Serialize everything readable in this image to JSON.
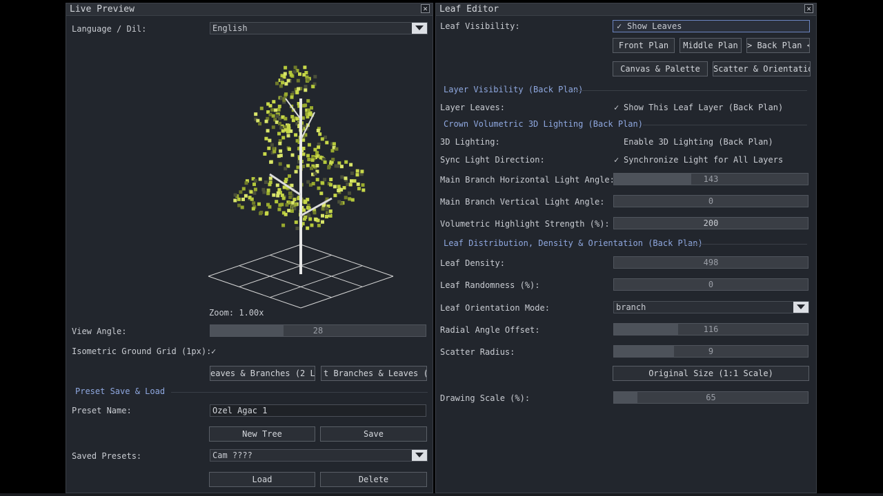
{
  "left_window": {
    "title": "Live Preview",
    "language_label": "Language / Dil:",
    "language_value": "English",
    "zoom_text": "Zoom: 1.00x",
    "view_angle_label": "View Angle:",
    "view_angle": {
      "value": "28",
      "fraction": 0.34
    },
    "grid_label": "Isometric Ground Grid (1px):",
    "grid_check": "✓",
    "tab_buttons": [
      "eaves & Branches (2 L",
      "t Branches & Leaves ("
    ],
    "preset_section": "Preset Save & Load",
    "preset_name_label": "Preset Name:",
    "preset_name_value": "Ozel Agac 1",
    "new_tree_label": "New Tree",
    "save_label": "Save",
    "saved_presets_label": "Saved Presets:",
    "saved_presets_value": "Cam ????",
    "load_label": "Load",
    "delete_label": "Delete"
  },
  "right_window": {
    "title": "Leaf Editor",
    "leaf_visibility_label": "Leaf Visibility:",
    "show_leaves_check": "✓",
    "show_leaves_label": "Show Leaves",
    "plan_buttons": [
      "Front Plan",
      "Middle Plan",
      "> Back Plan <"
    ],
    "canvas_palette_label": "Canvas & Palette",
    "scatter_orientation_label": "Scatter & Orientation",
    "layer_visibility_section": "Layer Visibility (Back Plan)",
    "layer_leaves_label": "Layer Leaves:",
    "layer_leaves_check": "✓",
    "layer_leaves_text": "Show This Leaf Layer (Back Plan)",
    "lighting_section": "Crown Volumetric 3D Lighting (Back Plan)",
    "lighting_label": "3D Lighting:",
    "lighting_text": "Enable 3D Lighting (Back Plan)",
    "sync_label": "Sync Light Direction:",
    "sync_check": "✓",
    "sync_text": "Synchronize Light for All Layers",
    "horiz_angle": {
      "label": "Main Branch Horizontal Light Angle:",
      "value": "143",
      "fraction": 0.4
    },
    "vert_angle": {
      "label": "Main Branch Vertical Light Angle:",
      "value": "0",
      "fraction": 0.0
    },
    "highlight": {
      "label": "Volumetric Highlight Strength (%):",
      "value": "200",
      "fraction": 0.0
    },
    "distribution_section": "Leaf Distribution, Density & Orientation (Back Plan)",
    "density": {
      "label": "Leaf Density:",
      "value": "498",
      "fraction": 0.0
    },
    "randomness": {
      "label": "Leaf Randomness (%):",
      "value": "0",
      "fraction": 0.0
    },
    "orientation_label": "Leaf Orientation Mode:",
    "orientation_value": "branch",
    "radial": {
      "label": "Radial Angle Offset:",
      "value": "116",
      "fraction": 0.33
    },
    "scatter": {
      "label": "Scatter Radius:",
      "value": "9",
      "fraction": 0.31
    },
    "original_size_label": "Original Size (1:1 Scale)",
    "drawing_scale": {
      "label": "Drawing Scale (%):",
      "value": "65",
      "fraction": 0.12
    }
  },
  "colors": {
    "accent": "#8fa8e0",
    "leaf_bright": "#c8d84a",
    "leaf_dark": "#6f7a2a",
    "trunk": "#e8e8e8"
  }
}
